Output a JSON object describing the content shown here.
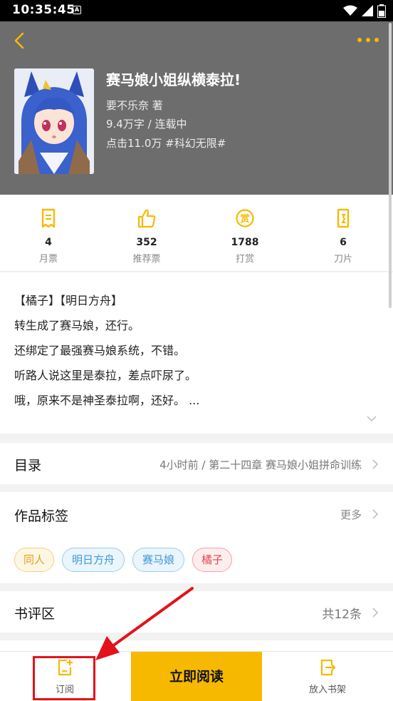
{
  "statusbar": {
    "time": "10:35:45",
    "notif_letter": "A"
  },
  "book": {
    "title": "赛马娘小姐纵横泰拉!",
    "author": "要不乐奈 著",
    "stats": "9.4万字 / 连载中",
    "meta": "点击11.0万 #科幻无限#"
  },
  "stats": [
    {
      "icon": "ticket-icon",
      "value": "4",
      "label": "月票"
    },
    {
      "icon": "thumbs-up-icon",
      "value": "352",
      "label": "推荐票"
    },
    {
      "icon": "reward-icon",
      "value": "1788",
      "label": "打赏"
    },
    {
      "icon": "blade-icon",
      "value": "6",
      "label": "刀片"
    }
  ],
  "intro": {
    "lines": [
      "【橘子】【明日方舟】",
      "转生成了赛马娘，还行。",
      "还绑定了最强赛马娘系统，不错。",
      "听路人说这里是泰拉，差点吓尿了。",
      "哦，原来不是神圣泰拉啊，还好。 ..."
    ]
  },
  "catalog": {
    "title": "目录",
    "latest": "4小时前 / 第二十四章 赛马娘小姐拼命训练"
  },
  "tags": {
    "title": "作品标签",
    "more": "更多",
    "items": [
      {
        "label": "同人",
        "color": "#e0a21c",
        "bg": "#fdf6e3"
      },
      {
        "label": "明日方舟",
        "color": "#3c9ad6",
        "bg": "#eaf5fc"
      },
      {
        "label": "赛马娘",
        "color": "#3c9ad6",
        "bg": "#eaf5fc"
      },
      {
        "label": "橘子",
        "color": "#e0484e",
        "bg": "#fdeeee"
      }
    ]
  },
  "reviews": {
    "title": "书评区",
    "count": "共12条"
  },
  "bottom": {
    "subscribe": "订阅",
    "read_now": "立即阅读",
    "add_shelf": "放入书架"
  },
  "colors": {
    "accent": "#f7b900",
    "highlight": "#e4121a"
  }
}
